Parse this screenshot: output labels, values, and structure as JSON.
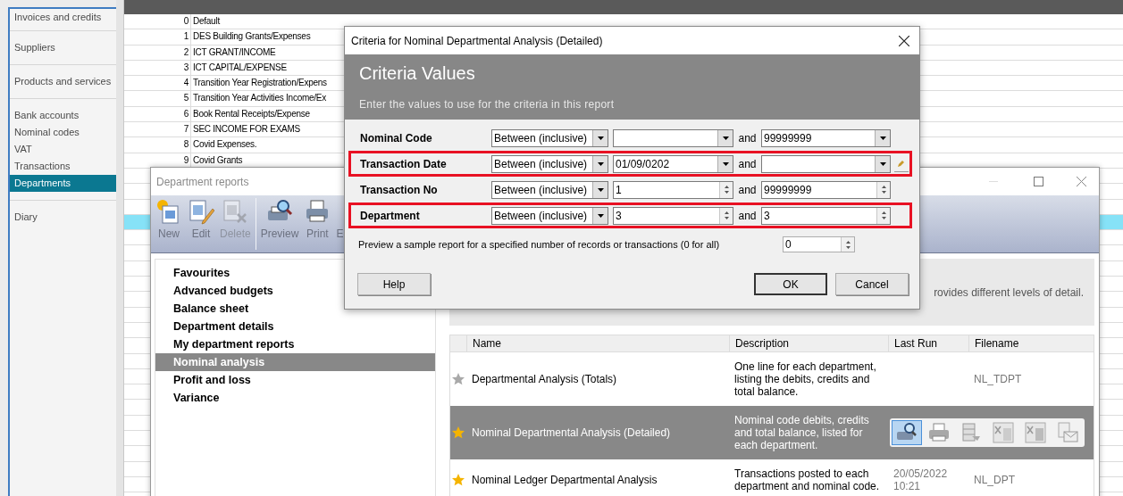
{
  "sidebar": {
    "sections": [
      {
        "items": [
          {
            "label": "Invoices and credits",
            "selected": false
          }
        ]
      },
      {
        "items": [
          {
            "label": "Suppliers",
            "selected": false
          }
        ]
      },
      {
        "items": [
          {
            "label": "Products and services",
            "selected": false
          }
        ]
      },
      {
        "items": [
          {
            "label": "Bank accounts",
            "selected": false
          },
          {
            "label": "Nominal codes",
            "selected": false
          },
          {
            "label": "VAT",
            "selected": false
          },
          {
            "label": "Transactions",
            "selected": false
          },
          {
            "label": "Departments",
            "selected": true
          }
        ]
      },
      {
        "items": [
          {
            "label": "Diary",
            "selected": false
          }
        ]
      }
    ]
  },
  "departments_table": {
    "rows": [
      {
        "reference": "0",
        "name": "Default"
      },
      {
        "reference": "1",
        "name": "DES Building Grants/Expenses"
      },
      {
        "reference": "2",
        "name": "ICT GRANT/INCOME"
      },
      {
        "reference": "3",
        "name": "ICT CAPITAL/EXPENSE"
      },
      {
        "reference": "4",
        "name": "Transition Year Registration/Expens"
      },
      {
        "reference": "5",
        "name": "Transition Year Activities Income/Ex"
      },
      {
        "reference": "6",
        "name": "Book Rental Receipts/Expense"
      },
      {
        "reference": "7",
        "name": "SEC INCOME FOR EXAMS"
      },
      {
        "reference": "8",
        "name": "Covid Expenses."
      },
      {
        "reference": "9",
        "name": "Covid Grants"
      }
    ],
    "blank_rows": [
      {
        "selected": false
      },
      {
        "selected": false
      },
      {
        "selected": false
      },
      {
        "selected": true
      },
      {
        "selected": false
      },
      {
        "selected": false
      },
      {
        "selected": false
      },
      {
        "selected": false
      },
      {
        "selected": false
      },
      {
        "selected": false
      },
      {
        "selected": false
      },
      {
        "selected": false
      },
      {
        "selected": false
      },
      {
        "selected": false
      },
      {
        "selected": false
      },
      {
        "selected": false
      },
      {
        "selected": false
      },
      {
        "selected": false
      },
      {
        "selected": false
      },
      {
        "selected": false
      },
      {
        "selected": false
      }
    ]
  },
  "reports_window": {
    "title": "Department reports",
    "toolbar": [
      {
        "kind": "new",
        "label": "New",
        "disabled": false
      },
      {
        "kind": "edit",
        "label": "Edit",
        "disabled": false
      },
      {
        "kind": "delete",
        "label": "Delete",
        "disabled": true
      },
      {
        "kind": "preview",
        "label": "Preview",
        "disabled": false
      },
      {
        "kind": "print",
        "label": "Print",
        "disabled": false
      },
      {
        "kind": "export",
        "label": "E",
        "disabled": false
      }
    ],
    "categories": [
      {
        "label": "Favourites",
        "selected": false
      },
      {
        "label": "Advanced budgets",
        "selected": false
      },
      {
        "label": "Balance sheet",
        "selected": false
      },
      {
        "label": "Department details",
        "selected": false
      },
      {
        "label": "My department reports",
        "selected": false
      },
      {
        "label": "Nominal analysis",
        "selected": true
      },
      {
        "label": "Profit and loss",
        "selected": false
      },
      {
        "label": "Variance",
        "selected": false
      }
    ],
    "info_text": "rovides different levels of detail.",
    "table": {
      "columns": [
        "Name",
        "Description",
        "Last Run",
        "Filename"
      ],
      "rows": [
        {
          "favourite": false,
          "selected": false,
          "name": "Departmental Analysis (Totals)",
          "description": "One line for each department, listing the debits, credits and total balance.",
          "filename": "NL_TDPT"
        },
        {
          "favourite": true,
          "selected": true,
          "name": "Nominal Departmental Analysis (Detailed)",
          "description": "Nominal code debits, credits and total balance, listed for each department."
        },
        {
          "favourite": true,
          "selected": false,
          "name": "Nominal Ledger Departmental Analysis",
          "description": "Transactions posted to each department and nominal code.",
          "last_run": "20/05/2022 10:21",
          "filename": "NL_DPT"
        }
      ]
    },
    "row_actions": [
      {
        "kind": "preview",
        "active": true
      },
      {
        "kind": "print",
        "active": false
      },
      {
        "kind": "export",
        "active": false
      },
      {
        "kind": "excel",
        "active": false
      },
      {
        "kind": "excel_data",
        "active": false
      },
      {
        "kind": "email",
        "active": false
      }
    ]
  },
  "dialog": {
    "title": "Criteria for Nominal Departmental Analysis (Detailed)",
    "heading": "Criteria Values",
    "subtitle": "Enter the values to use for the criteria in this report",
    "criteria": [
      {
        "label": "Nominal Code",
        "kind": "dropdown",
        "operator": "Between (inclusive)",
        "to": "99999999",
        "and": "and",
        "highlighted": false
      },
      {
        "label": "Transaction Date",
        "kind": "date",
        "operator": "Between (inclusive)",
        "from": "01/09/0202",
        "and": "and",
        "highlighted": true
      },
      {
        "label": "Transaction No",
        "kind": "spin",
        "operator": "Between (inclusive)",
        "from": "1",
        "to": "99999999",
        "and": "and",
        "highlighted": false
      },
      {
        "label": "Department",
        "kind": "spin",
        "operator": "Between (inclusive)",
        "from": "3",
        "to": "3",
        "and": "and",
        "highlighted": true
      }
    ],
    "preview_label": "Preview a sample report for a specified number of records or transactions (0 for all)",
    "preview_value": "0",
    "buttons": [
      {
        "label": "Help",
        "default": false
      },
      {
        "label": "OK",
        "default": true
      },
      {
        "label": "Cancel",
        "default": false
      }
    ]
  }
}
